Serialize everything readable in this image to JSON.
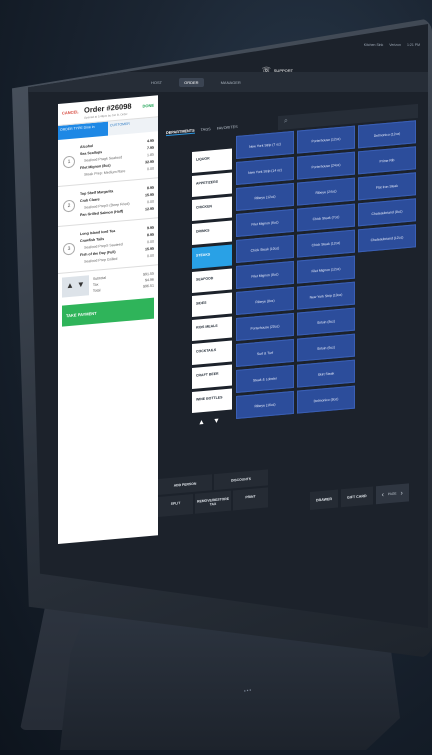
{
  "statusbar": {
    "text": "Kitchen Sink",
    "carrier": "Verizon",
    "time": "1:21 PM"
  },
  "topbar": {
    "logout_label": "LOG OUT",
    "tabs": [
      {
        "label": "HOST"
      },
      {
        "label": "ORDER"
      },
      {
        "label": "MANAGER"
      }
    ],
    "support_label": "SUPPORT"
  },
  "order": {
    "cancel_label": "CANCEL",
    "title": "Order #26098",
    "subtitle": "Opened at 5:48pm by Jon B. Order",
    "done_label": "DONE",
    "tabs": [
      {
        "label": "ORDER TYPE\nDine in"
      },
      {
        "label": "CUSTOMER"
      }
    ],
    "seats": [
      {
        "num": "1",
        "lines": [
          {
            "name": "Alcohol",
            "price": "4.95",
            "mod": false
          },
          {
            "name": "Sea Scallops",
            "price": "7.95",
            "mod": false
          },
          {
            "name": "Seafood Pragk Seafood",
            "price": "1.85",
            "mod": true
          },
          {
            "name": "Filet Mignon (8oz)",
            "price": "32.95",
            "mod": false
          },
          {
            "name": "Steak Prep: Medium Rare",
            "price": "0.00",
            "mod": true
          }
        ]
      },
      {
        "num": "2",
        "lines": [
          {
            "name": "Top Shelf Margarita",
            "price": "8.95",
            "mod": false
          },
          {
            "name": "Crab Claws",
            "price": "15.95",
            "mod": false
          },
          {
            "name": "Seafood PrepS (Deep Fried)",
            "price": "0.00",
            "mod": true
          },
          {
            "name": "Pan Grilled Salmon (Half)",
            "price": "12.95",
            "mod": false
          }
        ]
      },
      {
        "num": "3",
        "lines": [
          {
            "name": "Long Island Iced Tea",
            "price": "9.95",
            "mod": false
          },
          {
            "name": "Crawfish Tails",
            "price": "8.95",
            "mod": false
          },
          {
            "name": "Seafood PrepS Sauteed",
            "price": "0.00",
            "mod": true
          },
          {
            "name": "Fish of the Day (Full)",
            "price": "15.95",
            "mod": false
          },
          {
            "name": "Seafood Prep Grilled",
            "price": "0.00",
            "mod": true
          }
        ]
      }
    ],
    "subtotal_label": "Subtotal",
    "subtotal": "$91.55",
    "tax_label": "Tax",
    "tax": "$4.96",
    "total_label": "Total",
    "total": "$96.51",
    "take_payment_label": "TAKE PAYMENT"
  },
  "actions": {
    "row1": [
      {
        "label": "ADD PERSON"
      },
      {
        "label": "DISCOUNTS"
      }
    ],
    "row2": [
      {
        "label": "SPLIT"
      },
      {
        "label": "REMOVE/RESTORE TAX"
      },
      {
        "label": "PRINT"
      }
    ]
  },
  "subtabs": [
    {
      "label": "DEPARTMENTS"
    },
    {
      "label": "TAGS"
    },
    {
      "label": "FAVORITES"
    }
  ],
  "departments": [
    "LIQUOR",
    "APPETIZERS",
    "CHICKEN",
    "DRINKS",
    "STEAKS",
    "SEAFOOD",
    "SIDES",
    "KIDS MEALS",
    "COCKTAILS",
    "CRAFT BEER",
    "WINE BOTTLES"
  ],
  "items": [
    "New York Strip (7 oz)",
    "Porterhouse (12oz)",
    "Delmonico (12oz)",
    "New York Strip (14 oz)",
    "Porterhouse (24oz)",
    "Prime Rib",
    "Ribeye (12oz)",
    "Ribeye (24oz)",
    "Flat Iron Steak",
    "Filet Mignon (6oz)",
    "Chick Steak (7oz)",
    "Chateaubriand (8oz)",
    "Chick Steak (10oz)",
    "Chick Steak (12oz)",
    "Chateaubriand (12oz)",
    "Filet Mignon (8oz)",
    "Filet Mignon (12oz)",
    "",
    "Ribeye (8oz)",
    "New York Strip (10oz)",
    "",
    "Porterhouse (20oz)",
    "Sirloin (8oz)",
    "",
    "Surf & Turf",
    "Sirloin (6oz)",
    "",
    "Steak & Lobster",
    "Skirt Steak",
    "",
    "Ribeye (16oz)",
    "Delmonico (8oz)",
    ""
  ],
  "bottom": {
    "drawer_label": "DRAWER",
    "giftcard_label": "GIFT CARD",
    "page_label": "PAGE"
  }
}
